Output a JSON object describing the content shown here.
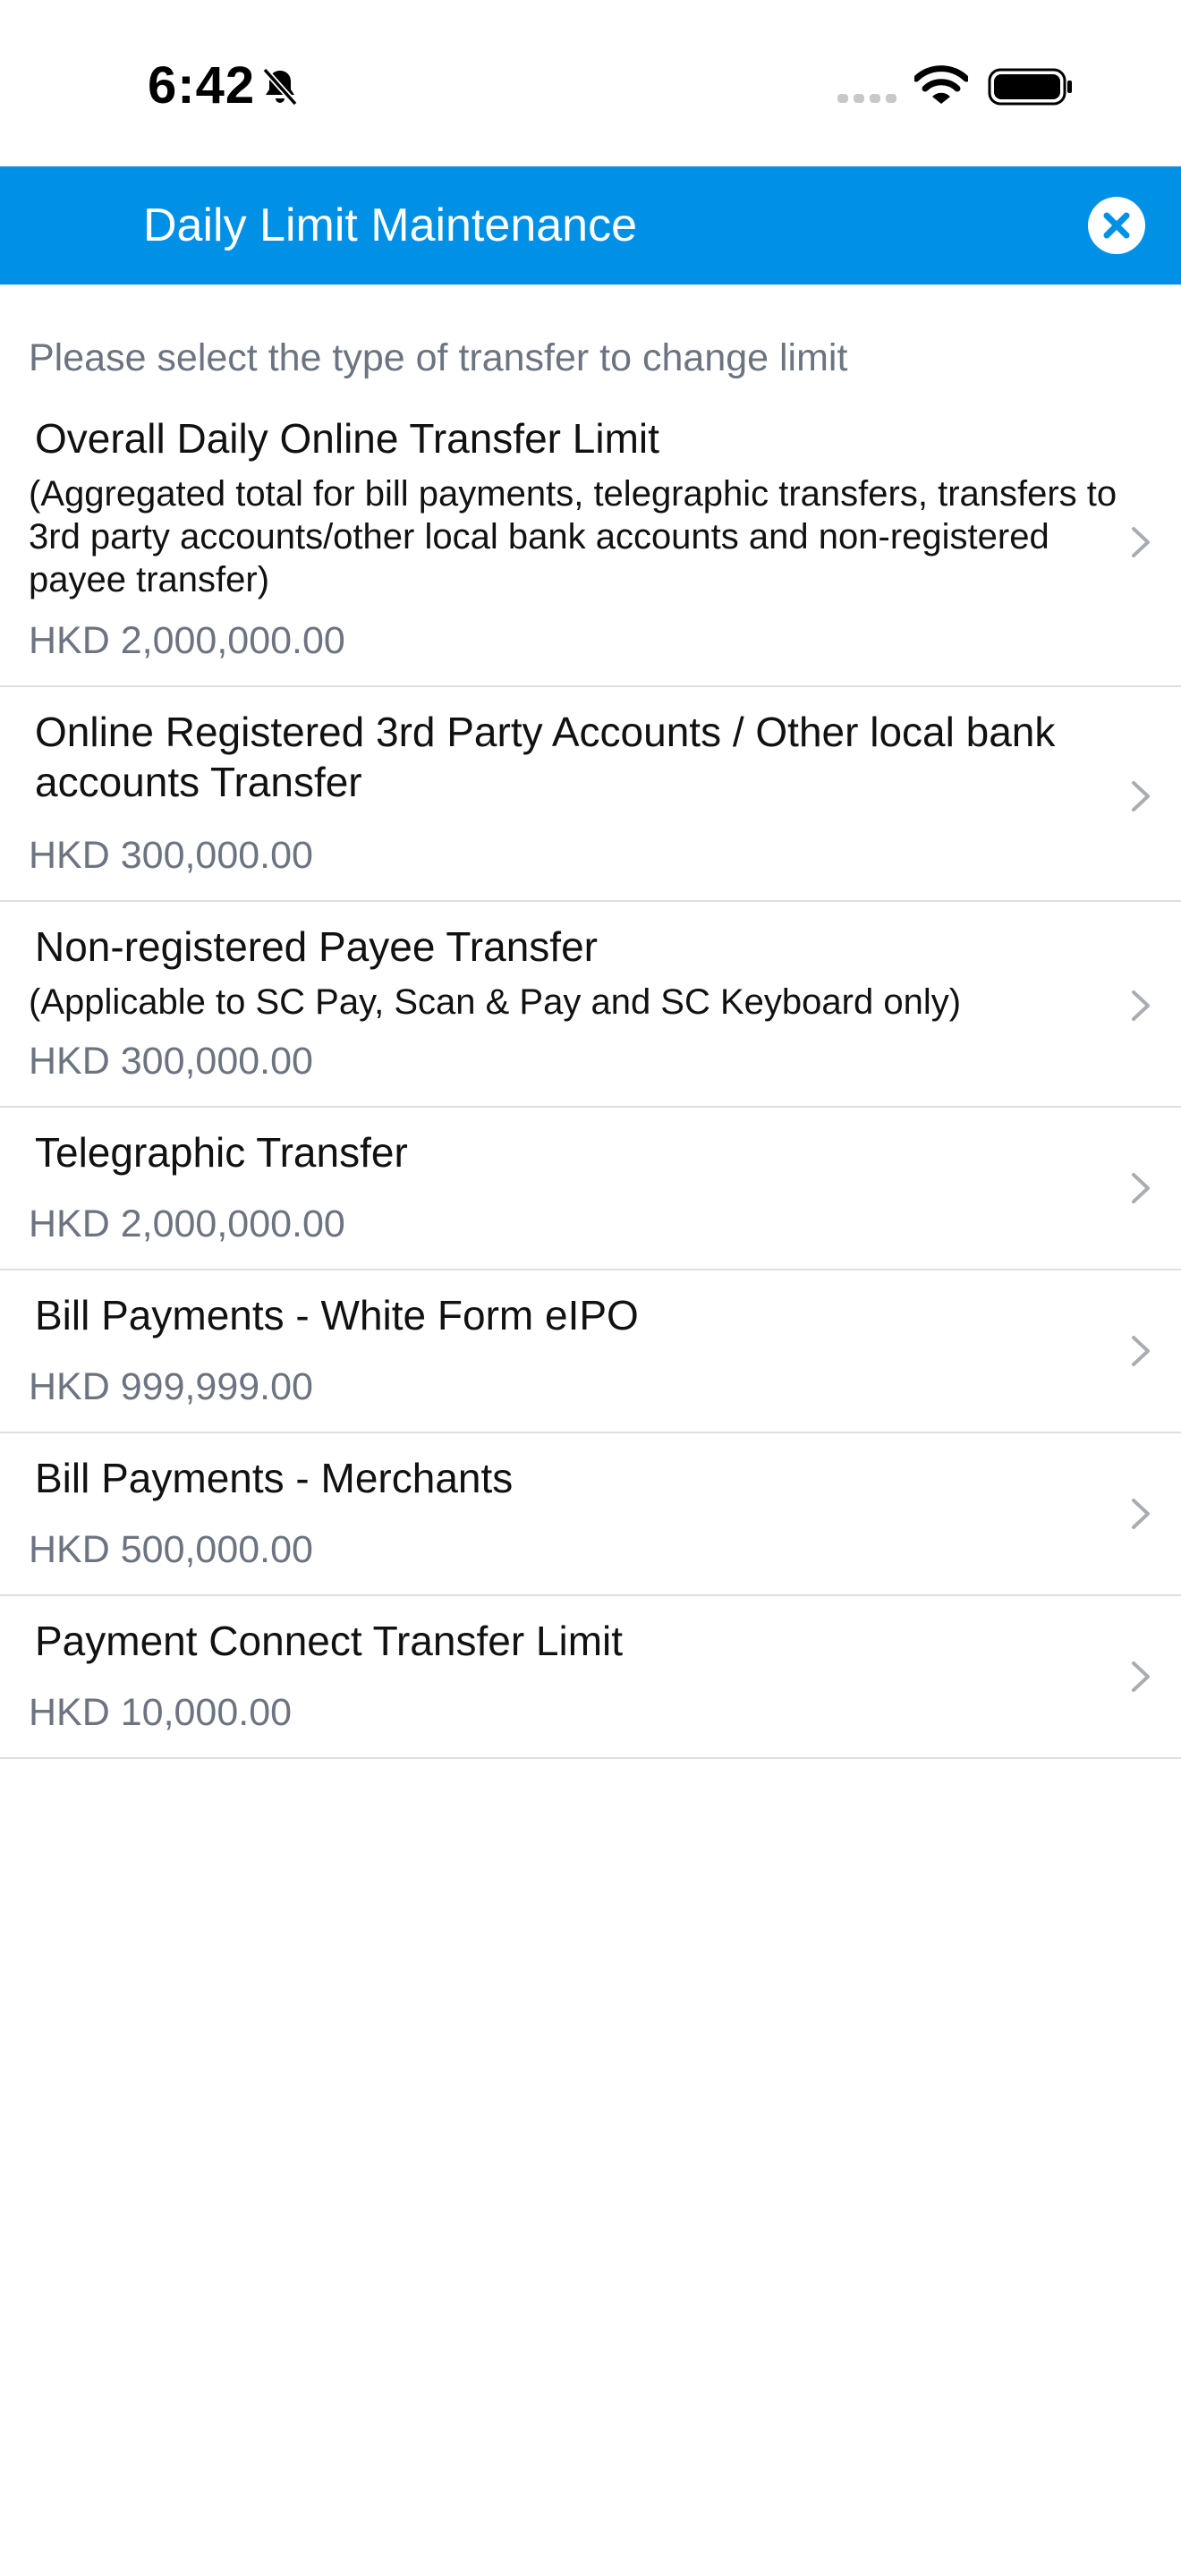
{
  "status_bar": {
    "time": "6:42"
  },
  "header": {
    "title": "Daily Limit Maintenance"
  },
  "intro": "Please select the type of transfer to change limit",
  "items": [
    {
      "title": "Overall Daily Online Transfer Limit",
      "description": "(Aggregated total for bill payments, telegraphic transfers, transfers to 3rd party accounts/other local bank accounts and non-registered payee transfer)",
      "amount": "HKD 2,000,000.00"
    },
    {
      "title": "Online Registered 3rd Party Accounts / Other local bank accounts Transfer",
      "amount": "HKD 300,000.00"
    },
    {
      "title": "Non-registered Payee Transfer",
      "description": "(Applicable to SC Pay, Scan & Pay and SC Keyboard only)",
      "amount": "HKD 300,000.00"
    },
    {
      "title": "Telegraphic Transfer",
      "amount": "HKD 2,000,000.00"
    },
    {
      "title": "Bill Payments - White Form eIPO",
      "amount": "HKD 999,999.00"
    },
    {
      "title": "Bill Payments - Merchants",
      "amount": "HKD 500,000.00"
    },
    {
      "title": "Payment Connect Transfer Limit",
      "amount": "HKD 10,000.00"
    }
  ],
  "colors": {
    "header_bg": "#0090e6",
    "secondary_text": "#6b7480",
    "divider": "#dcdfe3"
  }
}
